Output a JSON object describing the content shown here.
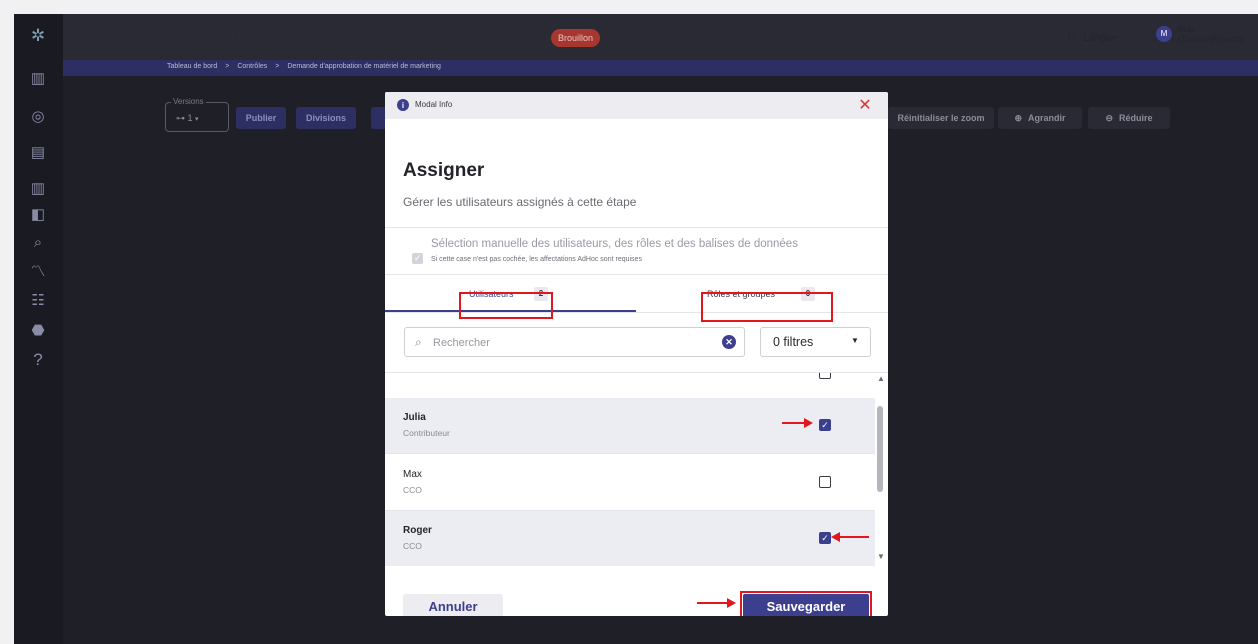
{
  "header": {
    "title": "Demande d'approbation de matériel de marketing",
    "status_badge": "Brouillon",
    "language_label": "Langue",
    "user_initial": "M",
    "user_name": "Max",
    "user_org": "(TrainingFrench)"
  },
  "breadcrumb": {
    "items": [
      "Tableau de bord",
      "Contrôles",
      "Demande d'approbation de matériel de marketing"
    ],
    "separator": ">"
  },
  "toolbar": {
    "versions_legend": "Versions",
    "versions_value": "1",
    "publish_label": "Publier",
    "divisions_label": "Divisions",
    "reset_zoom_label": "Réinitialiser le zoom",
    "zoom_in_label": "Agrandir",
    "zoom_out_label": "Réduire"
  },
  "modal": {
    "header_label": "Modal Info",
    "title": "Assigner",
    "subtitle": "Gérer les utilisateurs assignés à cette étape",
    "manual_label": "Sélection manuelle des utilisateurs, des rôles et des balises de données",
    "manual_note": "Si cette case n'est pas cochée, les affectations AdHoc sont requises",
    "tabs": [
      {
        "label": "Utilisateurs",
        "count": "2",
        "active": true
      },
      {
        "label": "Rôles et groupes",
        "count": "0",
        "active": false
      }
    ],
    "search_placeholder": "Rechercher",
    "filter_label": "0 filtres",
    "users": [
      {
        "name": "Julia",
        "role": "Contributeur",
        "checked": true
      },
      {
        "name": "Max",
        "role": "CCO",
        "checked": false
      },
      {
        "name": "Roger",
        "role": "CCO",
        "checked": true
      }
    ],
    "cancel_label": "Annuler",
    "save_label": "Sauvegarder"
  },
  "colors": {
    "accent": "#3c3f8e",
    "annotation_red": "#e2161e",
    "badge": "#a8362f"
  }
}
